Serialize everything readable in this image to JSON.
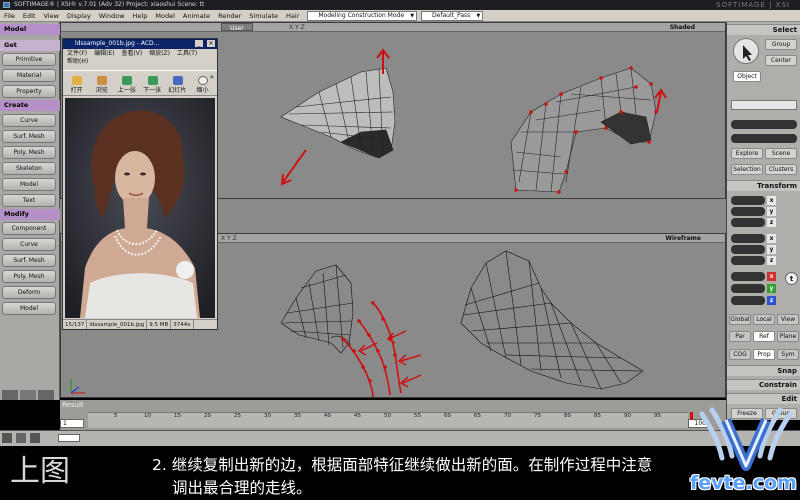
{
  "app": {
    "title": "SOFTIMAGE® | XSI® v.7.01 (Adv 32) Project: xiaoshui     Scene: tt",
    "brand": "SOFTIMAGE | XSI"
  },
  "menubar": {
    "items": [
      "File",
      "Edit",
      "View",
      "Display",
      "Window",
      "Help",
      "Model",
      "Animate",
      "Render",
      "Simulate",
      "Hair"
    ],
    "mode_select": "Modeling Construction Mode",
    "pass_select": "Default_Pass"
  },
  "left_panel": {
    "model_label": "Model",
    "get_label": "Get",
    "get_items": [
      "Primitive",
      "Material",
      "Property"
    ],
    "create_label": "Create",
    "create_items": [
      "Curve",
      "Surf. Mesh",
      "Poly. Mesh",
      "Skeleton",
      "Model",
      "Text"
    ],
    "modify_label": "Modify",
    "modify_items": [
      "Component",
      "Curve",
      "Surf. Mesh",
      "Poly. Mesh",
      "Deform",
      "Model"
    ]
  },
  "viewport_top": {
    "camera": "User",
    "axis": "X Y Z",
    "shading": "Shaded"
  },
  "viewport_bottom": {
    "axis": "X Y Z",
    "shading": "Wireframe"
  },
  "image_viewer": {
    "title": "ldssample_001b.jpg - ACD...",
    "menu_row1": [
      "文件(F)",
      "编辑(E)",
      "查看(V)",
      "缩放(Z)",
      "工具(T)"
    ],
    "menu_row2": [
      "帮助(H)"
    ],
    "tools": [
      "打开",
      "浏览",
      "上一张",
      "下一张",
      "幻灯片",
      "缩小"
    ],
    "more": "»",
    "status": [
      "15/137",
      "ldssample_001b.jpg",
      "9.5 MB",
      "3744x"
    ]
  },
  "right_panel": {
    "select_label": "Select",
    "group_btn": "Group",
    "center_btn": "Center",
    "object_btn": "Object",
    "explore_btn": "Explore",
    "scene_btn": "Scene",
    "selection_btn": "Selection",
    "clusters_btn": "Clusters",
    "transform_label": "Transform",
    "axes": [
      "x",
      "y",
      "z"
    ],
    "global_btn": "Global",
    "local_btn": "Local",
    "view_btn": "View",
    "par_btn": "Par",
    "ref_btn": "Ref",
    "plane_btn": "Plane",
    "cog_btn": "COG",
    "prop_btn": "Prop",
    "sym_btn": "Sym",
    "snap_label": "Snap",
    "constrain_label": "Constrain",
    "edit_label": "Edit",
    "freeze_btn": "Freeze",
    "group2_btn": "Group",
    "side_t": "t",
    "side_rgb": [
      "x",
      "y",
      "z"
    ]
  },
  "timeline": {
    "result_label": "Result",
    "start_frame": "1",
    "end_frame": "100",
    "ticks": [
      "5",
      "10",
      "15",
      "20",
      "25",
      "30",
      "35",
      "40",
      "45",
      "50",
      "55",
      "60",
      "65",
      "70",
      "75",
      "80",
      "85",
      "90",
      "95"
    ]
  },
  "caption": {
    "line1": "2. 继续复制出新的边，根据面部特征继续做出新的面。在制作过程中注意",
    "line2": "调出最合理的走线。",
    "corner_glyph": "上图"
  },
  "watermark": {
    "text": "fevte.com"
  },
  "colors": {
    "accent_purple": "#b590c8",
    "arrow_red": "#cc1111",
    "viewport_gray": "#8a8a8a"
  }
}
